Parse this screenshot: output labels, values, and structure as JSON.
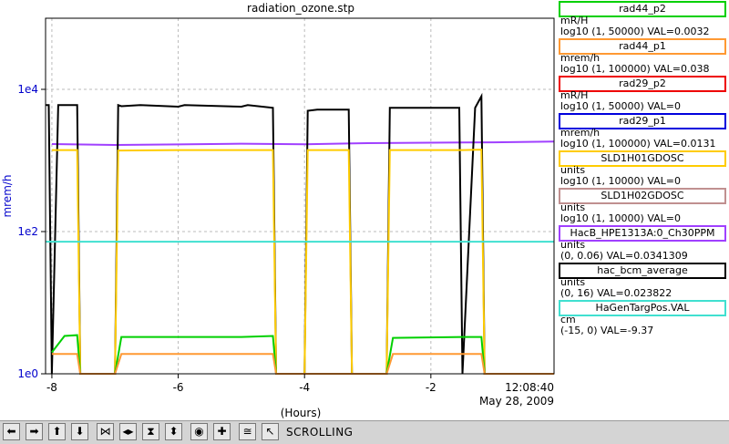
{
  "chart_data": {
    "type": "line",
    "title": "radiation_ozone.stp",
    "xlabel": "(Hours)",
    "ylabel": "mrem/h",
    "y_scale": "log",
    "xlim": [
      -8.1,
      -0.05
    ],
    "ylim": [
      1,
      100000
    ],
    "x_ticks": [
      -8,
      -6,
      -4,
      -2
    ],
    "x_tick_labels": [
      "-8",
      "-6",
      "-4",
      "-2"
    ],
    "y_ticks": [
      1,
      100,
      10000
    ],
    "y_tick_labels": [
      "1e0",
      "1e2",
      "1e4"
    ],
    "grid": true,
    "end_time": "12:08:40",
    "end_date": "May 28, 2009",
    "legend_position": "right",
    "series": [
      {
        "name": "HacB_HPE1313A:0_Ch30PPM",
        "color": "#a040ff",
        "x": [
          -8.0,
          -7.0,
          -6.0,
          -5.0,
          -4.0,
          -3.0,
          -2.0,
          -1.0,
          -0.05
        ],
        "y": [
          1700,
          1650,
          1680,
          1720,
          1690,
          1750,
          1780,
          1800,
          1850
        ]
      },
      {
        "name": "hac_bcm_average",
        "color": "#000000",
        "x": [
          -8.1,
          -8.05,
          -8.0,
          -7.9,
          -7.6,
          -7.55,
          -7.0,
          -6.95,
          -6.9,
          -6.6,
          -6.0,
          -5.9,
          -5.0,
          -4.9,
          -4.5,
          -4.45,
          -4.0,
          -3.95,
          -3.8,
          -3.3,
          -3.25,
          -2.7,
          -2.65,
          -1.55,
          -1.5,
          -1.3,
          -1.2,
          -1.15,
          -0.05
        ],
        "y": [
          6000,
          6000,
          1,
          6000,
          6000,
          1,
          1,
          6000,
          5800,
          6000,
          5700,
          6000,
          5700,
          6000,
          5500,
          1,
          1,
          5000,
          5200,
          5200,
          1,
          1,
          5500,
          5500,
          1,
          5500,
          8000,
          1,
          1
        ]
      },
      {
        "name": "rad44_p1",
        "color": "#ffcc00",
        "x": [
          -8.0,
          -7.6,
          -7.55,
          -7.0,
          -6.95,
          -6.0,
          -5.0,
          -4.5,
          -4.45,
          -4.0,
          -3.95,
          -3.3,
          -3.25,
          -2.7,
          -2.65,
          -1.5,
          -1.2,
          -1.15,
          -0.05
        ],
        "y": [
          1400,
          1400,
          1,
          1,
          1380,
          1400,
          1400,
          1400,
          1,
          1,
          1400,
          1400,
          1,
          1,
          1400,
          1400,
          1420,
          1,
          1
        ]
      },
      {
        "name": "HaGenTargPos.VAL",
        "color": "#40e0d0",
        "x": [
          -8.1,
          -0.05
        ],
        "y": [
          72,
          72
        ]
      },
      {
        "name": "rad29_p1",
        "color": "#00d000",
        "x": [
          -8.0,
          -7.8,
          -7.6,
          -7.55,
          -7.0,
          -6.9,
          -6.0,
          -5.0,
          -4.5,
          -4.45,
          -3.3,
          -3.25,
          -2.7,
          -2.6,
          -1.5,
          -1.2,
          -1.15,
          -0.05
        ],
        "y": [
          2,
          3.4,
          3.5,
          1,
          1,
          3.3,
          3.3,
          3.3,
          3.4,
          1,
          1,
          1,
          1,
          3.2,
          3.3,
          3.3,
          1,
          1
        ]
      },
      {
        "name": "rad44_p2",
        "color": "#ff9933",
        "x": [
          -8.0,
          -7.6,
          -7.55,
          -7.0,
          -6.9,
          -6.0,
          -5.0,
          -4.5,
          -4.45,
          -2.7,
          -2.6,
          -1.5,
          -1.2,
          -1.15,
          -0.05
        ],
        "y": [
          1.9,
          1.9,
          1,
          1,
          1.9,
          1.9,
          1.9,
          1.9,
          1,
          1,
          1.9,
          1.9,
          1.9,
          1,
          1
        ]
      }
    ]
  },
  "legend": [
    {
      "name": "rad44_p2",
      "unit": "mR/H",
      "range": "log10 (1, 50000) VAL=0.0032",
      "color": "#00d000"
    },
    {
      "name": "rad44_p1",
      "unit": "mrem/h",
      "range": "log10 (1, 100000) VAL=0.038",
      "color": "#ff9933"
    },
    {
      "name": "rad29_p2",
      "unit": "mR/H",
      "range": "log10 (1, 50000) VAL=0",
      "color": "#ee0000"
    },
    {
      "name": "rad29_p1",
      "unit": "mrem/h",
      "range": "log10 (1, 100000) VAL=0.0131",
      "color": "#0000dd"
    },
    {
      "name": "SLD1H01GDOSC",
      "unit": "units",
      "range": "log10 (1, 10000) VAL=0",
      "color": "#ffcc00"
    },
    {
      "name": "SLD1H02GDOSC",
      "unit": "units",
      "range": "log10 (1, 10000) VAL=0",
      "color": "#c09090"
    },
    {
      "name": "HacB_HPE1313A:0_Ch30PPM",
      "unit": "units",
      "range": "(0, 0.06) VAL=0.0341309",
      "color": "#a040ff"
    },
    {
      "name": "hac_bcm_average",
      "unit": "units",
      "range": "(0, 16) VAL=0.023822",
      "color": "#000000"
    },
    {
      "name": "HaGenTargPos.VAL",
      "unit": "cm",
      "range": "(-15, 0) VAL=-9.37",
      "color": "#40e0d0"
    }
  ],
  "toolbar": {
    "status": "SCROLLING",
    "buttons": [
      {
        "name": "scroll-left-button",
        "glyph": "⬅",
        "icon": "arrow-left-icon"
      },
      {
        "name": "scroll-right-button",
        "glyph": "➡",
        "icon": "arrow-right-icon"
      },
      {
        "name": "scroll-up-button",
        "glyph": "⬆",
        "icon": "arrow-up-icon"
      },
      {
        "name": "scroll-down-button",
        "glyph": "⬇",
        "icon": "arrow-down-icon"
      },
      {
        "name": "zoom-in-x-button",
        "glyph": "⋈",
        "icon": "zoom-in-horizontal-icon"
      },
      {
        "name": "zoom-out-x-button",
        "glyph": "◂▸",
        "icon": "zoom-out-horizontal-icon"
      },
      {
        "name": "zoom-in-y-button",
        "glyph": "⧗",
        "icon": "zoom-in-vertical-icon"
      },
      {
        "name": "zoom-out-y-button",
        "glyph": "⬍",
        "icon": "zoom-out-vertical-icon"
      },
      {
        "name": "autoscale-button",
        "glyph": "◉",
        "icon": "circle-icon"
      },
      {
        "name": "add-marker-button",
        "glyph": "✚",
        "icon": "plus-icon"
      },
      {
        "name": "toggle-scroll-button",
        "glyph": "≅",
        "icon": "waveform-icon"
      },
      {
        "name": "pointer-button",
        "glyph": "↖",
        "icon": "pointer-arrow-icon"
      }
    ]
  }
}
